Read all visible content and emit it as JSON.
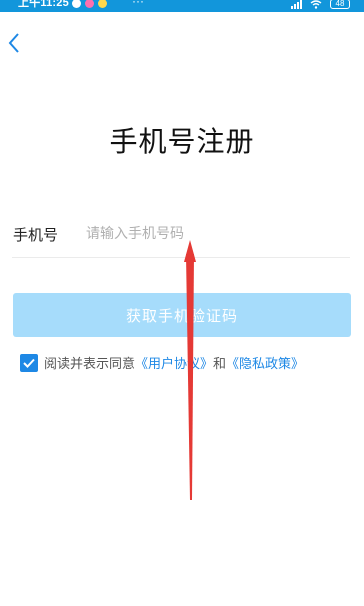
{
  "status_bar": {
    "time": "上午11:25",
    "more": "···",
    "battery": "48",
    "background_color": "#1296db"
  },
  "header": {
    "back_icon": "chevron-left-icon"
  },
  "main": {
    "title": "手机号注册",
    "phone_label": "手机号",
    "phone_value": "",
    "phone_placeholder": "请输入手机号码",
    "get_code_button_label": "获取手机验证码",
    "agreement": {
      "checked": true,
      "prefix": "阅读并表示同意",
      "user_agreement": "《用户协议》",
      "and": "和",
      "privacy_policy": "《隐私政策》"
    }
  },
  "colors": {
    "accent": "#1e88e5",
    "button_disabled": "#a6dcfb",
    "annotation_arrow": "#e53935"
  }
}
